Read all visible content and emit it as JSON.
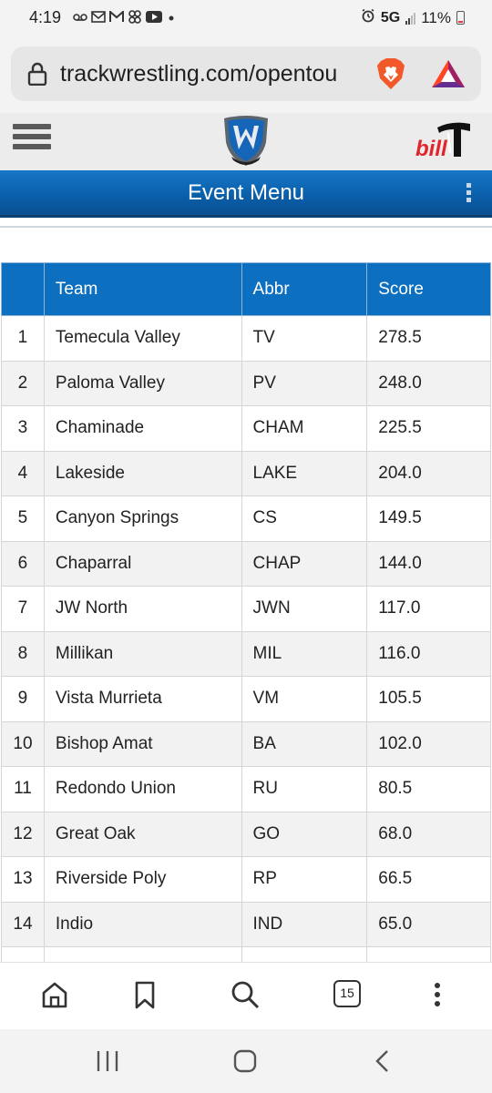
{
  "status": {
    "time": "4:19",
    "network": "5G",
    "battery": "11%"
  },
  "browser": {
    "url": "trackwrestling.com/opentou",
    "tab_count": "15"
  },
  "site": {
    "brand_text": "bill"
  },
  "event_menu": {
    "title": "Event Menu"
  },
  "table": {
    "headers": [
      "",
      "Team",
      "Abbr",
      "Score"
    ],
    "rows": [
      {
        "rank": "1",
        "team": "Temecula Valley",
        "abbr": "TV",
        "score": "278.5"
      },
      {
        "rank": "2",
        "team": "Paloma Valley",
        "abbr": "PV",
        "score": "248.0"
      },
      {
        "rank": "3",
        "team": "Chaminade",
        "abbr": "CHAM",
        "score": "225.5"
      },
      {
        "rank": "4",
        "team": "Lakeside",
        "abbr": "LAKE",
        "score": "204.0"
      },
      {
        "rank": "5",
        "team": "Canyon Springs",
        "abbr": "CS",
        "score": "149.5"
      },
      {
        "rank": "6",
        "team": "Chaparral",
        "abbr": "CHAP",
        "score": "144.0"
      },
      {
        "rank": "7",
        "team": "JW North",
        "abbr": "JWN",
        "score": "117.0"
      },
      {
        "rank": "8",
        "team": "Millikan",
        "abbr": "MIL",
        "score": "116.0"
      },
      {
        "rank": "9",
        "team": "Vista Murrieta",
        "abbr": "VM",
        "score": "105.5"
      },
      {
        "rank": "10",
        "team": "Bishop Amat",
        "abbr": "BA",
        "score": "102.0"
      },
      {
        "rank": "11",
        "team": "Redondo Union",
        "abbr": "RU",
        "score": "80.5"
      },
      {
        "rank": "12",
        "team": "Great Oak",
        "abbr": "GO",
        "score": "68.0"
      },
      {
        "rank": "13",
        "team": "Riverside Poly",
        "abbr": "RP",
        "score": "66.5"
      },
      {
        "rank": "14",
        "team": "Indio",
        "abbr": "IND",
        "score": "65.0"
      },
      {
        "rank": "",
        "team": "",
        "abbr": "",
        "score": ""
      }
    ]
  },
  "icons": {
    "status": [
      "voicemail-icon",
      "email-icon",
      "gmail-icon",
      "app-icon",
      "youtube-icon",
      "dot-icon"
    ],
    "toolbar": [
      "home-icon",
      "bookmark-icon",
      "search-icon",
      "tabs-icon",
      "more-icon"
    ],
    "navbar": [
      "recent-apps-icon",
      "home-nav-icon",
      "back-icon"
    ]
  },
  "colors": {
    "header_blue": "#0c6fc0",
    "brand_red": "#e0262b"
  }
}
